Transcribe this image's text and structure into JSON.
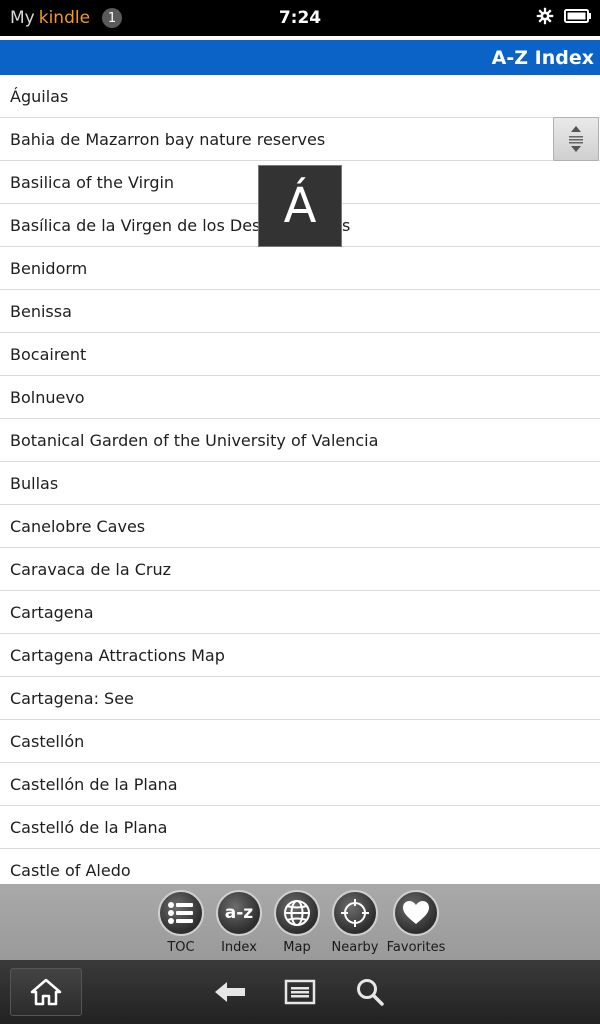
{
  "status_bar": {
    "brand_my": "My",
    "brand_kindle": "kindle",
    "notification_count": "1",
    "time": "7:24"
  },
  "header": {
    "title": "A-Z Index"
  },
  "letter_popup": "Á",
  "list": [
    "Águilas",
    "Bahia de Mazarron bay nature reserves",
    "Basilica of the Virgin",
    "Basílica de la Virgen de los Desamparados",
    "Benidorm",
    "Benissa",
    "Bocairent",
    "Bolnuevo",
    "Botanical Garden of the University of Valencia",
    "Bullas",
    "Canelobre Caves",
    "Caravaca de la Cruz",
    "Cartagena",
    "Cartagena Attractions Map",
    "Cartagena: See",
    "Castellón",
    "Castellón de la Plana",
    "Castelló de la Plana",
    "Castle of Aledo"
  ],
  "toolbar": {
    "toc": "TOC",
    "index": "Index",
    "index_glyph": "a-z",
    "map": "Map",
    "nearby": "Nearby",
    "favorites": "Favorites"
  },
  "icons": {
    "settings": "gear-icon",
    "battery": "battery-icon",
    "home": "home-icon",
    "back": "back-arrow-icon",
    "menu": "menu-icon",
    "search": "search-icon"
  },
  "colors": {
    "header_bg": "#0b63c8",
    "kindle_orange": "#f29a1f"
  }
}
